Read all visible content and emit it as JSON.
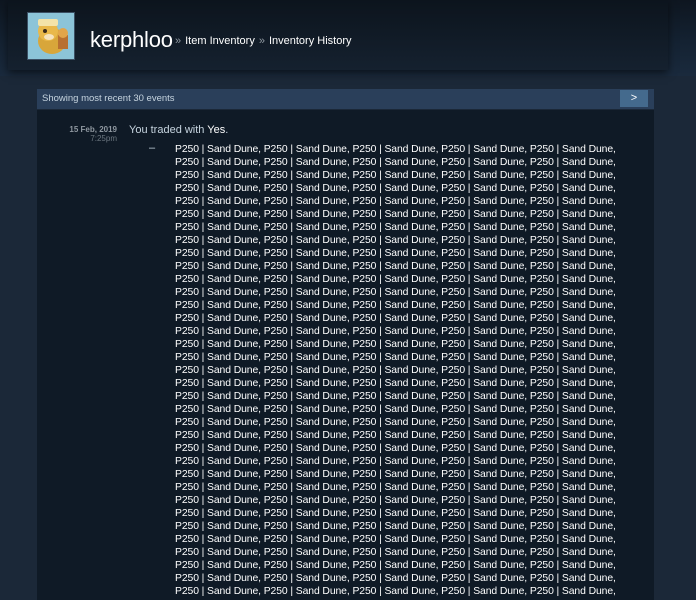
{
  "header": {
    "persona_name": "kerphloo",
    "breadcrumb_separator": "»",
    "breadcrumbs": [
      "Item Inventory",
      "Inventory History"
    ]
  },
  "events_panel": {
    "count_label": "Showing most recent 30 events",
    "next_page_label": ">"
  },
  "event": {
    "date": "15 Feb, 2019",
    "time": "7:25pm",
    "description_prefix": "You traded with",
    "partner_name": "Yes",
    "description_suffix": ".",
    "items_label": "–",
    "item_name": "P250 | Sand Dune",
    "items_per_row": 5,
    "visible_rows": 35
  },
  "colors": {
    "page_background": "#1b2838",
    "panel_header": "#2a3f5a",
    "event_background": "#0f1a26",
    "text_primary": "#c6d4df",
    "text_muted": "#8f98a0",
    "next_button": "#446a8d"
  }
}
